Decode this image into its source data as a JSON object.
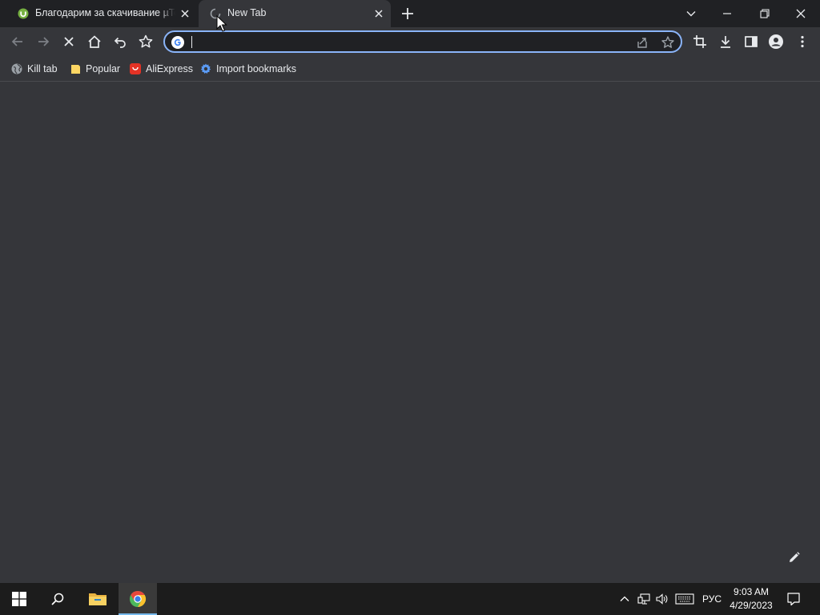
{
  "tabs": [
    {
      "title": "Благодарим за скачивание µTorrent",
      "favicon": "utorrent-icon",
      "active": false
    },
    {
      "title": "New Tab",
      "favicon": "loading-spinner-icon",
      "active": true
    }
  ],
  "window_controls": [
    "tab-search",
    "minimize",
    "restore",
    "close"
  ],
  "toolbar": {
    "buttons": [
      "back",
      "forward",
      "stop",
      "home",
      "undo",
      "bookmark"
    ],
    "omnibox": {
      "value": "",
      "placeholder": ""
    },
    "right_buttons": [
      "crop",
      "download",
      "side-panel",
      "profile",
      "menu"
    ]
  },
  "bookmarks": [
    {
      "label": "Kill tab",
      "icon": "globe-icon"
    },
    {
      "label": "Popular",
      "icon": "folder-icon"
    },
    {
      "label": "AliExpress",
      "icon": "aliexpress-icon"
    },
    {
      "label": "Import bookmarks",
      "icon": "gear-icon"
    }
  ],
  "taskbar": {
    "apps": [
      "start",
      "search",
      "file-explorer",
      "chrome"
    ],
    "language": "РУС",
    "time": "9:03 AM",
    "date": "4/29/2023"
  },
  "colors": {
    "frame": "#202124",
    "toolbar": "#35363a",
    "accent": "#8ab4f8",
    "taskbar": "#1c1c1c"
  }
}
